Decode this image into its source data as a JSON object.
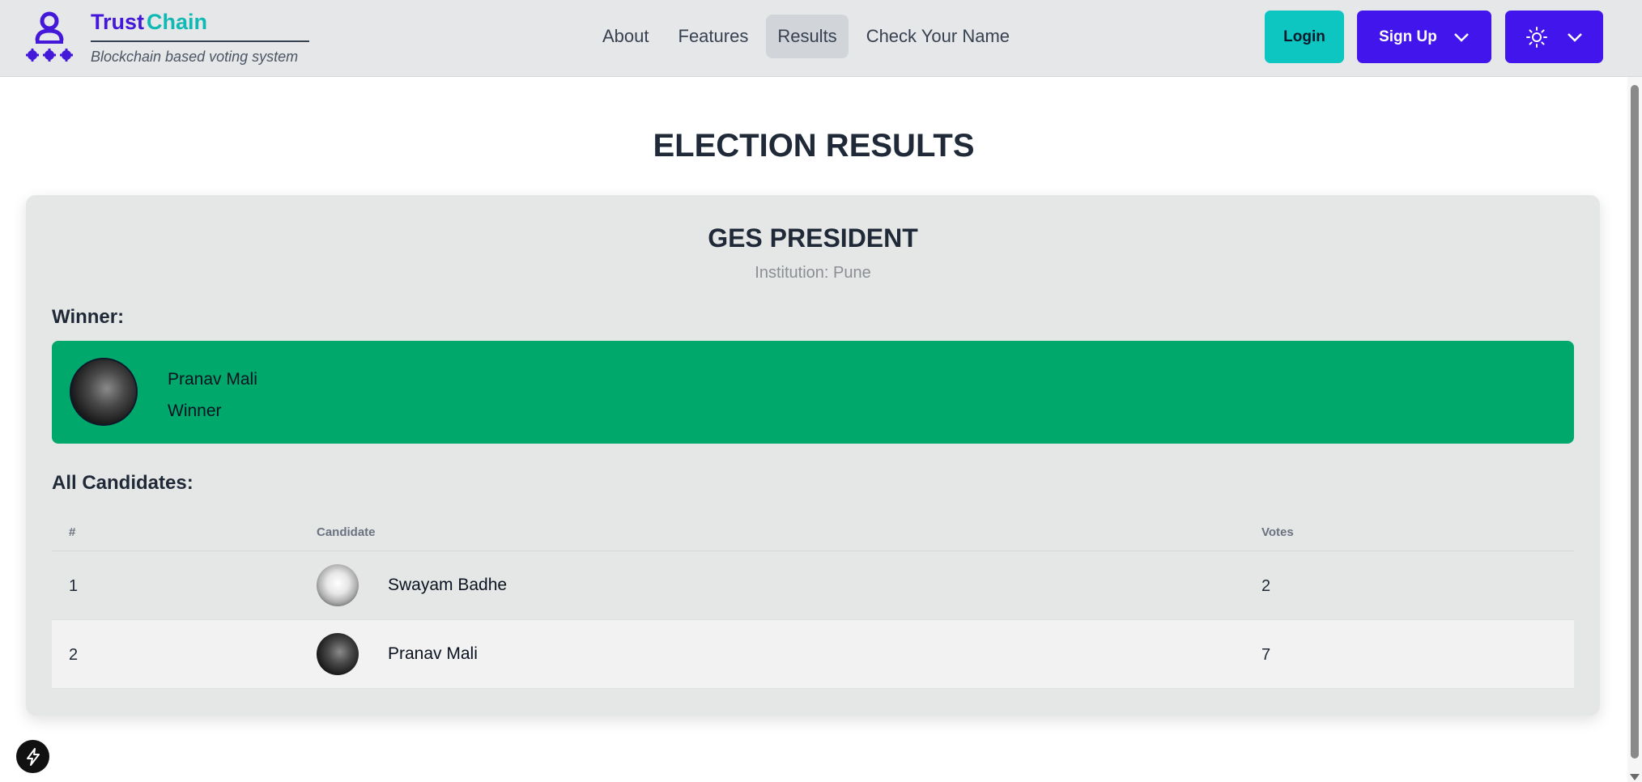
{
  "brand": {
    "name_part1": "Trust",
    "name_part2": "Chain",
    "tagline": "Blockchain based voting system",
    "logo_icon": "voters-group-icon"
  },
  "nav": {
    "items": [
      {
        "label": "About",
        "active": false
      },
      {
        "label": "Features",
        "active": false
      },
      {
        "label": "Results",
        "active": true
      },
      {
        "label": "Check Your Name",
        "active": false
      }
    ]
  },
  "actions": {
    "login_label": "Login",
    "signup_label": "Sign Up",
    "theme_icon": "sun-icon"
  },
  "colors": {
    "brand_purple": "#4115ec",
    "brand_teal": "#0ec6c1",
    "winner_green": "#00a86b"
  },
  "page": {
    "title": "ELECTION RESULTS"
  },
  "election": {
    "title": "GES PRESIDENT",
    "institution": "Institution: Pune",
    "winner_heading": "Winner:",
    "winner": {
      "name": "Pranav Mali",
      "label": "Winner"
    },
    "candidates_heading": "All Candidates:",
    "table": {
      "headers": {
        "num": "#",
        "candidate": "Candidate",
        "votes": "Votes"
      },
      "rows": [
        {
          "num": "1",
          "name": "Swayam Badhe",
          "votes": "2"
        },
        {
          "num": "2",
          "name": "Pranav Mali",
          "votes": "7"
        }
      ]
    }
  }
}
